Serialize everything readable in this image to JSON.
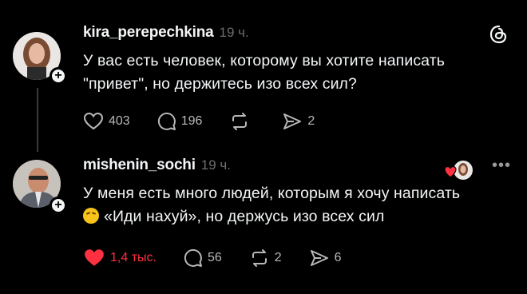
{
  "posts": [
    {
      "username": "kira_perepechkina",
      "time": "19 ч.",
      "text": "У вас есть человек, которому вы хотите написать \"привет\", но держитесь изо всех сил?",
      "likes": "403",
      "replies": "196",
      "reposts": "",
      "shares": "2"
    },
    {
      "username": "mishenin_sochi",
      "time": "19 ч.",
      "text_line1": "У меня есть много людей, которым я хочу написать",
      "text_line2": "«Иди нахуй», но держусь изо всех сил",
      "likes": "1,4 тыс.",
      "replies": "56",
      "reposts": "2",
      "shares": "6",
      "more": "•••"
    }
  ],
  "colors": {
    "background": "#000000",
    "text": "#f3f5f7",
    "muted": "#6e6e6e",
    "like": "#ff3040"
  },
  "icons": [
    "threads-logo-icon",
    "heart-icon",
    "comment-icon",
    "repost-icon",
    "share-icon",
    "more-icon",
    "plus-icon"
  ]
}
